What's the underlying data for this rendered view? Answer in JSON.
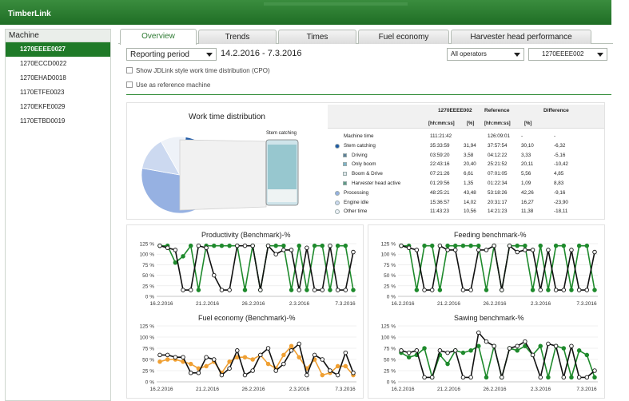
{
  "app": {
    "title": "TimberLink"
  },
  "sidebar": {
    "header": "Machine",
    "items": [
      "1270EEEE0027",
      "1270ECCD0022",
      "1270EHAD0018",
      "1170ETFE0023",
      "1270EKFE0029",
      "1170ETBD0019"
    ]
  },
  "tabs": [
    "Overview",
    "Trends",
    "Times",
    "Fuel economy",
    "Harvester head performance"
  ],
  "controls": {
    "period_label": "Reporting period",
    "date_range": "14.2.2016 - 7.3.2016",
    "operators": "All operators",
    "machine": "1270EEEE002",
    "chk_jdlink": "Show JDLink style work time distribution (CPO)",
    "chk_reference": "Use as reference machine"
  },
  "wtd": {
    "title": "Work time distribution",
    "stem_label": "Stem catching",
    "col_machine": "1270EEEE002",
    "col_reference": "Reference",
    "col_difference": "Difference",
    "unit_time": "[hh:mm:ss]",
    "unit_pct": "[%]",
    "rows": [
      {
        "name": "Machine time",
        "time": "111:21:42",
        "pct": "",
        "ref_time": "126:09:01",
        "ref_pct": "-",
        "diff": "-"
      },
      {
        "name": "Stem catching",
        "time": "35:33:59",
        "pct": "31,94",
        "ref_time": "37:57:54",
        "ref_pct": "30,10",
        "diff": "-6,32"
      },
      {
        "name": "Driving",
        "time": "03:59:20",
        "pct": "3,58",
        "ref_time": "04:12:22",
        "ref_pct": "3,33",
        "diff": "-5,16"
      },
      {
        "name": "Only boom",
        "time": "22:43:16",
        "pct": "20,40",
        "ref_time": "25:21:52",
        "ref_pct": "20,11",
        "diff": "-10,42"
      },
      {
        "name": "Boom & Drive",
        "time": "07:21:26",
        "pct": "6,61",
        "ref_time": "07:01:05",
        "ref_pct": "5,56",
        "diff": "4,85"
      },
      {
        "name": "Harvester head active",
        "time": "01:29:56",
        "pct": "1,35",
        "ref_time": "01:22:34",
        "ref_pct": "1,09",
        "diff": "8,83"
      },
      {
        "name": "Processing",
        "time": "48:25:21",
        "pct": "43,48",
        "ref_time": "53:18:26",
        "ref_pct": "42,26",
        "diff": "-9,16"
      },
      {
        "name": "Engine idle",
        "time": "15:36:57",
        "pct": "14,02",
        "ref_time": "20:31:17",
        "ref_pct": "16,27",
        "diff": "-23,90"
      },
      {
        "name": "Other time",
        "time": "11:43:23",
        "pct": "10,56",
        "ref_time": "14:21:23",
        "ref_pct": "11,38",
        "diff": "-18,11"
      }
    ],
    "pie": [
      {
        "label": "Stem catching",
        "value": 31.94,
        "color": "#1f5aa6"
      },
      {
        "label": "Processing",
        "value": 43.48,
        "color": "#96b1e2"
      },
      {
        "label": "Engine idle",
        "value": 14.02,
        "color": "#ccd9f0"
      },
      {
        "label": "Other time",
        "value": 10.56,
        "color": "#eef2f8"
      }
    ]
  },
  "colors": {
    "green": "#1e8a2c",
    "black": "#111111",
    "orange": "#f0a033"
  },
  "chart_data": [
    {
      "type": "line",
      "title": "Productivity (Benchmark)-%",
      "x_ticks": [
        "16.2.2016",
        "21.2.2016",
        "26.2.2016",
        "2.3.2016",
        "7.3.2016"
      ],
      "y_ticks": [
        "125 %",
        "100 %",
        "75 %",
        "50 %",
        "25 %",
        "0 %"
      ],
      "ylim": [
        0,
        125
      ],
      "series": [
        {
          "color": "#1e8a2c",
          "values": [
            120,
            120,
            80,
            95,
            120,
            15,
            120,
            120,
            120,
            120,
            120,
            15,
            120,
            15,
            120,
            120,
            120,
            15,
            120,
            15,
            120,
            120,
            15,
            120,
            120,
            15
          ]
        },
        {
          "color": "#111111",
          "values": [
            120,
            115,
            110,
            15,
            15,
            120,
            115,
            50,
            15,
            15,
            120,
            120,
            120,
            15,
            120,
            100,
            110,
            110,
            15,
            115,
            15,
            15,
            120,
            15,
            15,
            105
          ]
        }
      ]
    },
    {
      "type": "line",
      "title": "Feeding benchmark-%",
      "x_ticks": [
        "16.2.2016",
        "21.2.2016",
        "26.2.2016",
        "2.3.2016",
        "7.3.2016"
      ],
      "y_ticks": [
        "125 %",
        "100 %",
        "75 %",
        "50 %",
        "25 %",
        "0 %"
      ],
      "ylim": [
        0,
        125
      ],
      "series": [
        {
          "color": "#1e8a2c",
          "values": [
            120,
            120,
            15,
            120,
            120,
            15,
            120,
            120,
            120,
            120,
            120,
            15,
            120,
            15,
            120,
            120,
            120,
            15,
            120,
            15,
            120,
            120,
            15,
            120,
            120,
            15
          ]
        },
        {
          "color": "#111111",
          "values": [
            120,
            115,
            110,
            15,
            15,
            120,
            110,
            110,
            15,
            15,
            110,
            110,
            120,
            15,
            120,
            105,
            110,
            110,
            15,
            110,
            15,
            15,
            110,
            15,
            15,
            105
          ]
        }
      ]
    },
    {
      "type": "line",
      "title": "Fuel economy (Benchmark)-%",
      "x_ticks": [
        "16.2.2016",
        "21.2.2016",
        "26.2.2016",
        "2.3.2016",
        "7.3.2016"
      ],
      "y_ticks": [
        "125 %",
        "100 %",
        "75 %",
        "50 %",
        "25 %",
        "0 %"
      ],
      "ylim": [
        0,
        125
      ],
      "series": [
        {
          "color": "#f0a033",
          "values": [
            45,
            50,
            50,
            45,
            40,
            30,
            35,
            45,
            20,
            45,
            55,
            55,
            50,
            60,
            40,
            30,
            60,
            80,
            55,
            30,
            50,
            15,
            20,
            35,
            35,
            15
          ]
        },
        {
          "color": "#111111",
          "values": [
            60,
            60,
            55,
            55,
            20,
            20,
            55,
            50,
            15,
            30,
            70,
            15,
            25,
            60,
            75,
            25,
            40,
            70,
            85,
            15,
            60,
            50,
            25,
            15,
            65,
            20
          ]
        }
      ]
    },
    {
      "type": "line",
      "title": "Sawing benchmark-%",
      "x_ticks": [
        "16.2.2016",
        "21.2.2016",
        "26.2.2016",
        "2.3.2016",
        "7.3.2016"
      ],
      "y_ticks": [
        "125 %",
        "100 %",
        "75 %",
        "50 %",
        "25 %",
        "0 %"
      ],
      "ylim": [
        0,
        125
      ],
      "series": [
        {
          "color": "#1e8a2c",
          "values": [
            65,
            55,
            60,
            75,
            10,
            60,
            40,
            70,
            65,
            70,
            80,
            10,
            80,
            10,
            75,
            70,
            80,
            60,
            80,
            10,
            80,
            75,
            10,
            70,
            60,
            10
          ]
        },
        {
          "color": "#111111",
          "values": [
            70,
            65,
            70,
            10,
            10,
            70,
            65,
            70,
            10,
            10,
            110,
            90,
            80,
            10,
            75,
            80,
            90,
            60,
            10,
            85,
            80,
            10,
            80,
            10,
            10,
            25
          ]
        }
      ]
    }
  ]
}
